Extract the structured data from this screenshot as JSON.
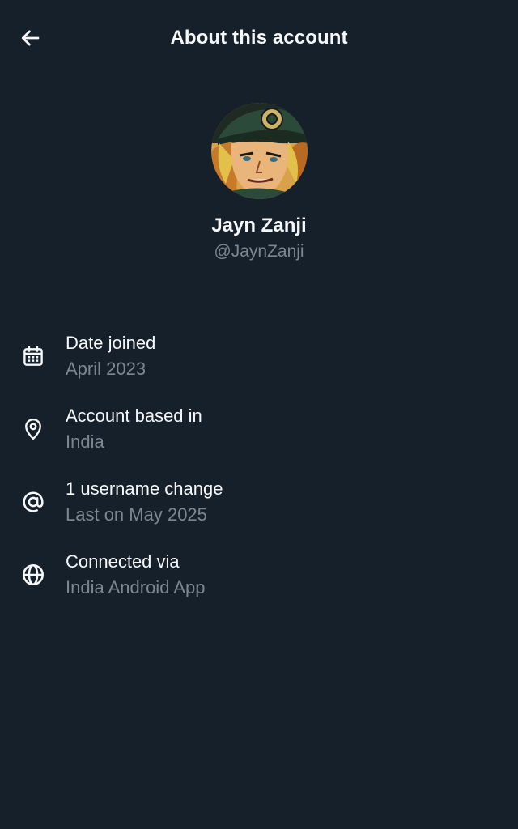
{
  "header": {
    "title": "About this account",
    "back_icon": "arrow-left-icon"
  },
  "profile": {
    "display_name": "Jayn Zanji",
    "handle": "@JaynZanji",
    "avatar": "avatar-image"
  },
  "info": [
    {
      "icon": "calendar-icon",
      "title": "Date joined",
      "subtitle": "April 2023"
    },
    {
      "icon": "location-pin-icon",
      "title": "Account based in",
      "subtitle": "India"
    },
    {
      "icon": "at-sign-icon",
      "title": "1 username change",
      "subtitle": "Last on May 2025"
    },
    {
      "icon": "globe-icon",
      "title": "Connected via",
      "subtitle": "India Android App"
    }
  ],
  "colors": {
    "background": "#16202b",
    "primary_text": "#f5f7f9",
    "secondary_text": "#7c8791"
  }
}
